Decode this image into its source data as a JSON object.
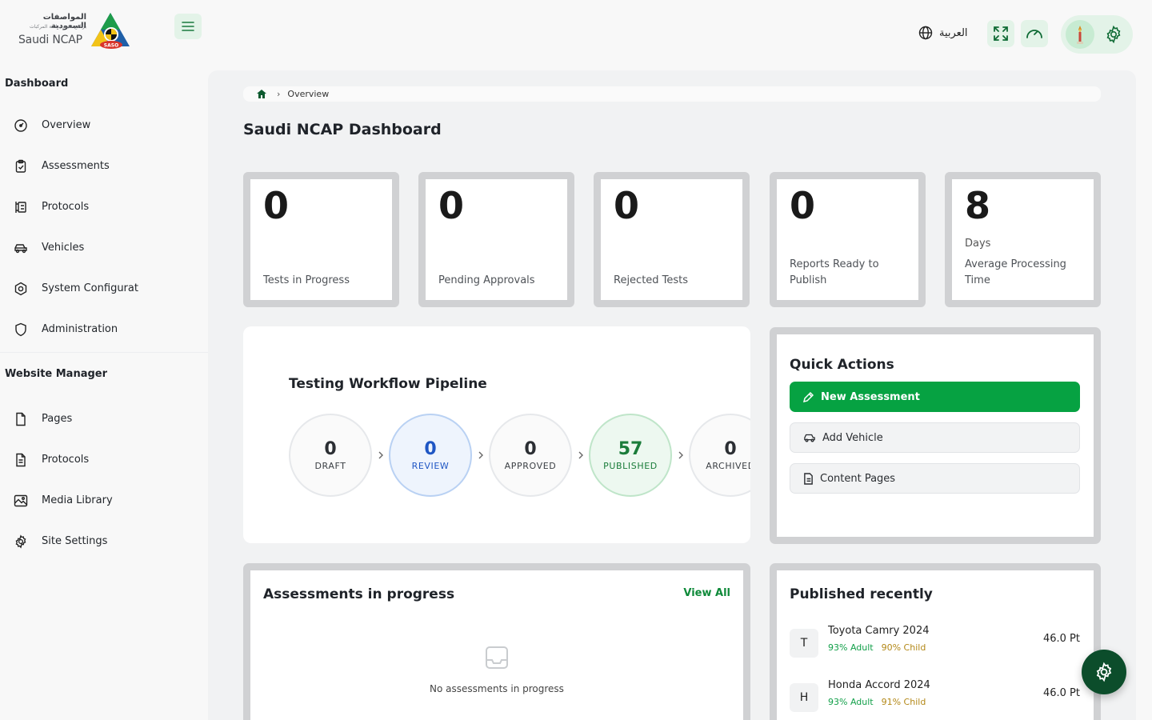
{
  "header": {
    "logo_arabic_title": "المواصفات السعودية",
    "logo_arabic_subtitle": "برنامج تقييم سلامة المركبات",
    "logo_brand": "Saudi NCAP",
    "logo_badge": "SASO",
    "language_label": "العربية",
    "icons": [
      "menu-icon",
      "globe-icon",
      "fullscreen-icon",
      "speed-icon",
      "avatar",
      "gear-icon"
    ]
  },
  "sidebar": {
    "dashboard_title": "Dashboard",
    "dashboard_items": [
      {
        "label": "Overview",
        "icon": "gauge-icon"
      },
      {
        "label": "Assessments",
        "icon": "clipboard-check-icon"
      },
      {
        "label": "Protocols",
        "icon": "protocol-icon"
      },
      {
        "label": "Vehicles",
        "icon": "car-icon"
      },
      {
        "label": "System Configuration",
        "icon": "hexagon-settings-icon"
      },
      {
        "label": "Administration",
        "icon": "shield-icon"
      }
    ],
    "website_title": "Website Manager",
    "website_items": [
      {
        "label": "Pages",
        "icon": "file-icon"
      },
      {
        "label": "Protocols",
        "icon": "file-text-icon"
      },
      {
        "label": "Media Library",
        "icon": "image-icon"
      },
      {
        "label": "Site Settings",
        "icon": "gear-icon"
      }
    ]
  },
  "breadcrumb": {
    "current": "Overview"
  },
  "page_title": "Saudi NCAP Dashboard",
  "stats": [
    {
      "value": "0",
      "unit": "",
      "label": "Tests in Progress"
    },
    {
      "value": "0",
      "unit": "",
      "label": "Pending Approvals"
    },
    {
      "value": "0",
      "unit": "",
      "label": "Rejected Tests"
    },
    {
      "value": "0",
      "unit": "",
      "label": "Reports Ready to Publish"
    },
    {
      "value": "8",
      "unit": "Days",
      "label": "Average Processing Time"
    }
  ],
  "pipeline": {
    "title": "Testing Workflow Pipeline",
    "stages": [
      {
        "value": "0",
        "label": "DRAFT"
      },
      {
        "value": "0",
        "label": "REVIEW"
      },
      {
        "value": "0",
        "label": "APPROVED"
      },
      {
        "value": "57",
        "label": "PUBLISHED"
      },
      {
        "value": "0",
        "label": "ARCHIVED"
      }
    ]
  },
  "quick_actions": {
    "title": "Quick Actions",
    "buttons": [
      {
        "label": "New Assessment",
        "icon": "pen-icon"
      },
      {
        "label": "Add Vehicle",
        "icon": "car-icon"
      },
      {
        "label": "Content Pages",
        "icon": "file-text-icon"
      }
    ]
  },
  "assessments": {
    "title": "Assessments in progress",
    "view_all": "View All",
    "empty_message": "No assessments in progress"
  },
  "published": {
    "title": "Published recently",
    "items": [
      {
        "initial": "T",
        "name": "Toyota Camry 2024",
        "adult": "93% Adult",
        "child": "90% Child",
        "points": "46.0 Pt"
      },
      {
        "initial": "H",
        "name": "Honda Accord 2024",
        "adult": "93% Adult",
        "child": "91% Child",
        "points": "46.0 Pt"
      }
    ]
  },
  "colors": {
    "primary_green": "#06a242",
    "dark_green": "#0c4d2b",
    "light_green_bg": "#e3f3e8",
    "review_blue": "#1f56c4",
    "child_gold": "#b38817"
  }
}
